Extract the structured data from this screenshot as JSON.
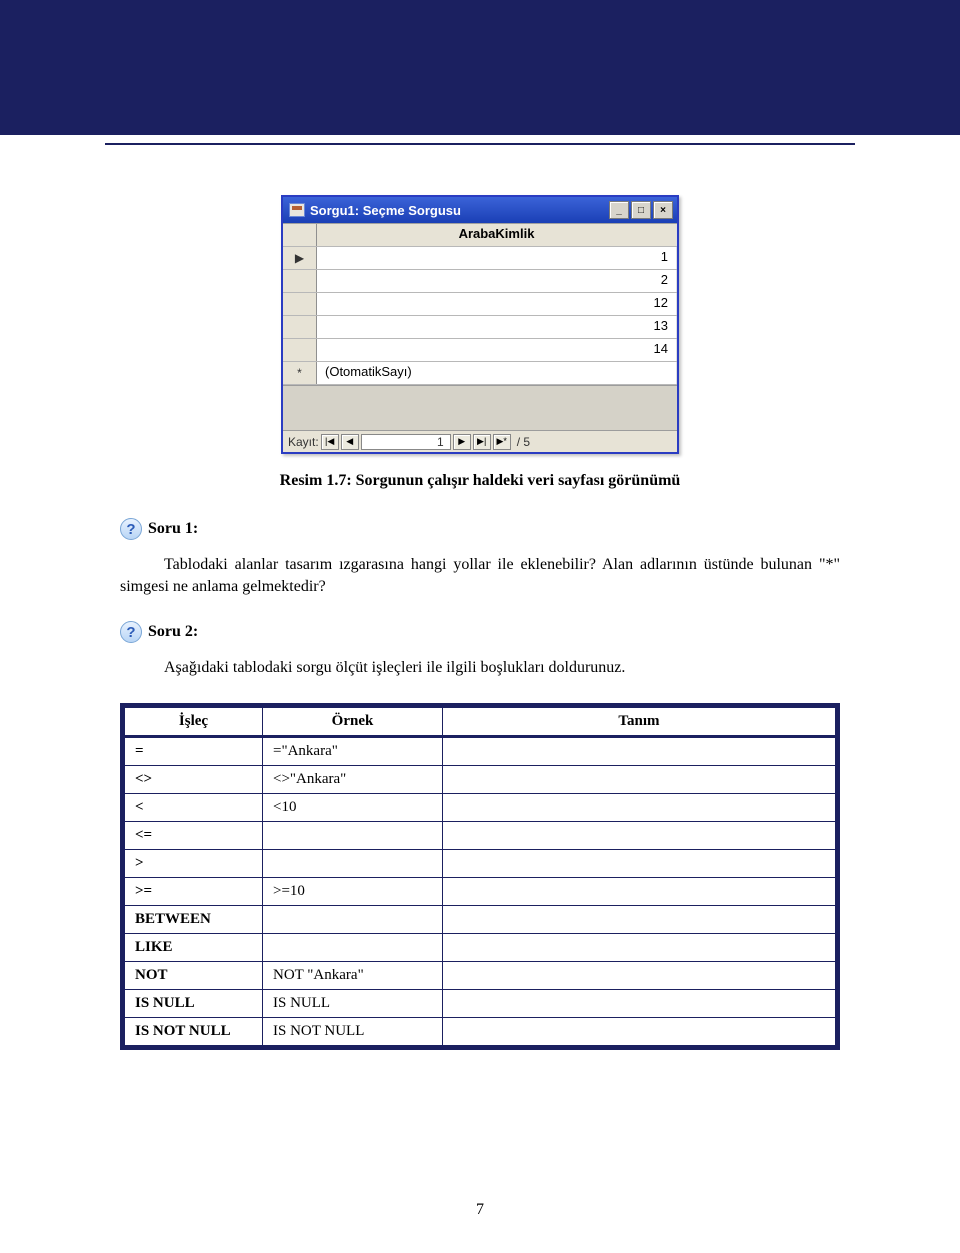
{
  "window": {
    "title": "Sorgu1: Seçme Sorgusu",
    "column_header": "ArabaKimlik",
    "rows": [
      {
        "marker": "▶",
        "value": "1"
      },
      {
        "marker": "",
        "value": "2"
      },
      {
        "marker": "",
        "value": "12"
      },
      {
        "marker": "",
        "value": "13"
      },
      {
        "marker": "",
        "value": "14"
      },
      {
        "marker": "*",
        "value": "(OtomatikSayı)"
      }
    ],
    "nav": {
      "label": "Kayıt:",
      "first": "|◀",
      "prev": "◀",
      "current": "1",
      "next": "▶",
      "last": "▶|",
      "new": "▶*",
      "of": "/ 5"
    },
    "min_btn": "_",
    "max_btn": "□",
    "close_btn": "×"
  },
  "caption": "Resim 1.7: Sorgunun çalışır haldeki veri sayfası görünümü",
  "q1": {
    "icon": "?",
    "label": "Soru 1:",
    "text": "Tablodaki alanlar tasarım ızgarasına hangi yollar ile eklenebilir? Alan adlarının üstünde bulunan \"*\" simgesi ne anlama gelmektedir?"
  },
  "q2": {
    "icon": "?",
    "label": "Soru 2:",
    "text": "Aşağıdaki tablodaki sorgu ölçüt işleçleri ile ilgili boşlukları doldurunuz."
  },
  "table": {
    "headers": {
      "col1": "İşleç",
      "col2": "Örnek",
      "col3": "Tanım"
    },
    "rows": [
      {
        "op": "=",
        "ex": "=\"Ankara\"",
        "def": ""
      },
      {
        "op": "<>",
        "ex": "<>\"Ankara\"",
        "def": ""
      },
      {
        "op": "<",
        "ex": "<10",
        "def": ""
      },
      {
        "op": "<=",
        "ex": "",
        "def": ""
      },
      {
        "op": ">",
        "ex": "",
        "def": ""
      },
      {
        "op": ">=",
        "ex": ">=10",
        "def": ""
      },
      {
        "op": "BETWEEN",
        "ex": "",
        "def": ""
      },
      {
        "op": "LIKE",
        "ex": "",
        "def": ""
      },
      {
        "op": "NOT",
        "ex": "NOT \"Ankara\"",
        "def": ""
      },
      {
        "op": "IS NULL",
        "ex": "IS NULL",
        "def": ""
      },
      {
        "op": "IS NOT NULL",
        "ex": "IS NOT NULL",
        "def": ""
      }
    ]
  },
  "page_number": "7"
}
